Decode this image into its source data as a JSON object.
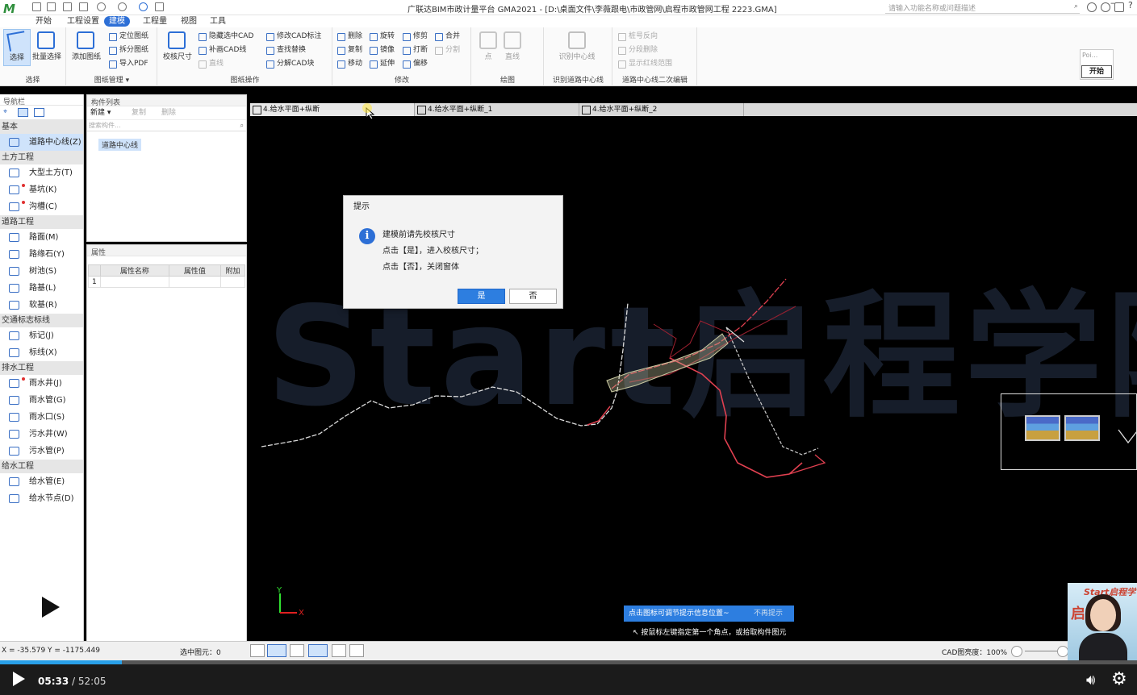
{
  "titlebar": {
    "title": "广联达BIM市政计量平台 GMA2021 - [D:\\桌面文件\\李薇跟电\\市政管网\\启程市政管网工程 2223.GMA]",
    "search_placeholder": "请输入功能名称或问题描述"
  },
  "menu": {
    "tabs": [
      "开始",
      "工程设置",
      "建模",
      "工程量",
      "视图",
      "工具"
    ],
    "active": "建模"
  },
  "ribbon": {
    "select": {
      "select_label": "选择",
      "batch_label": "批量选择",
      "group": "选择"
    },
    "drawing": {
      "add_label": "添加图纸",
      "locate": "定位图纸",
      "split": "拆分图纸",
      "export_pdf": "导入PDF",
      "group": "图纸管理 ▾"
    },
    "drawing_ops": {
      "check_label": "校核尺寸",
      "hide_cad": "隐藏选中CAD",
      "fix_cad": "补画CAD线",
      "line": "直线",
      "modify_cad": "修改CAD标注",
      "find_replace": "查找替换",
      "decompose": "分解CAD块",
      "group": "图纸操作"
    },
    "modify": {
      "delete": "删除",
      "rotate": "旋转",
      "trim": "修剪",
      "merge": "合并",
      "copy": "复制",
      "mirror": "镜像",
      "break": "打断",
      "split": "分割",
      "move": "移动",
      "extend": "延伸",
      "offset": "偏移",
      "group": "修改"
    },
    "draw": {
      "point": "点",
      "line": "直线",
      "group": "绘图"
    },
    "identify": {
      "label": "识别中心线",
      "group": "识别道路中心线"
    },
    "secondary": {
      "reverse": "桩号反向",
      "split_delete": "分段删除",
      "show_range": "显示红线范围",
      "group": "道路中心线二次编辑"
    },
    "start": {
      "placeholder": "Poi...",
      "button": "开始"
    }
  },
  "nav": {
    "title": "导航栏",
    "categories": [
      {
        "name": "基本",
        "items": [
          {
            "label": "道路中心线(Z)",
            "selected": true,
            "dot": false
          }
        ]
      },
      {
        "name": "土方工程",
        "items": [
          {
            "label": "大型土方(T)",
            "dot": false
          },
          {
            "label": "基坑(K)",
            "dot": true
          },
          {
            "label": "沟槽(C)",
            "dot": true
          }
        ]
      },
      {
        "name": "道路工程",
        "items": [
          {
            "label": "路面(M)",
            "dot": false
          },
          {
            "label": "路缘石(Y)",
            "dot": false
          },
          {
            "label": "树池(S)",
            "dot": false
          },
          {
            "label": "路基(L)",
            "dot": false
          },
          {
            "label": "软基(R)",
            "dot": false
          }
        ]
      },
      {
        "name": "交通标志标线",
        "items": [
          {
            "label": "标记(J)",
            "dot": false
          },
          {
            "label": "标线(X)",
            "dot": false
          }
        ]
      },
      {
        "name": "排水工程",
        "items": [
          {
            "label": "雨水井(J)",
            "dot": true
          },
          {
            "label": "雨水管(G)",
            "dot": false
          },
          {
            "label": "雨水口(S)",
            "dot": false
          },
          {
            "label": "污水井(W)",
            "dot": false
          },
          {
            "label": "污水管(P)",
            "dot": false
          }
        ]
      },
      {
        "name": "给水工程",
        "items": [
          {
            "label": "给水管(E)",
            "dot": false
          },
          {
            "label": "给水节点(D)",
            "dot": false
          }
        ]
      }
    ]
  },
  "complist": {
    "title": "构件列表",
    "new": "新建 ▾",
    "copy": "复制",
    "delete": "删除",
    "search_placeholder": "搜索构件...",
    "item": "道路中心线"
  },
  "props": {
    "title": "属性",
    "headers": [
      "属性名称",
      "属性值",
      "附加"
    ],
    "row1": "1"
  },
  "doctabs": [
    "4.给水平面+纵断",
    "4.给水平面+纵断_1",
    "4.给水平面+纵断_2"
  ],
  "canvas": {
    "watermark": "Start启程学院",
    "tip": "点击图标可调节提示信息位置~",
    "tip_nomore": "不再提示",
    "hint": "按鼠标左键指定第一个角点，或拾取构件图元",
    "axis_y": "Y",
    "axis_x": "X"
  },
  "dialog": {
    "title": "提示",
    "line1": "建模前请先校核尺寸",
    "line2": "点击【是】，进入校核尺寸；",
    "line3": "点击【否】，关闭窗体",
    "yes": "是",
    "no": "否"
  },
  "status": {
    "coords": "X = -35.579 Y = -1175.449",
    "selected": "选中图元：0",
    "cad_brightness": "CAD图亮度：100%"
  },
  "webcam": {
    "brand": "Start启程学",
    "text": "启"
  },
  "player": {
    "current": "05:33",
    "total": "/ 52:05",
    "progress": 0.107
  },
  "colors": {
    "accent": "#2d6fd6",
    "tip": "#2d7ee0",
    "progress": "#29a0e8"
  }
}
